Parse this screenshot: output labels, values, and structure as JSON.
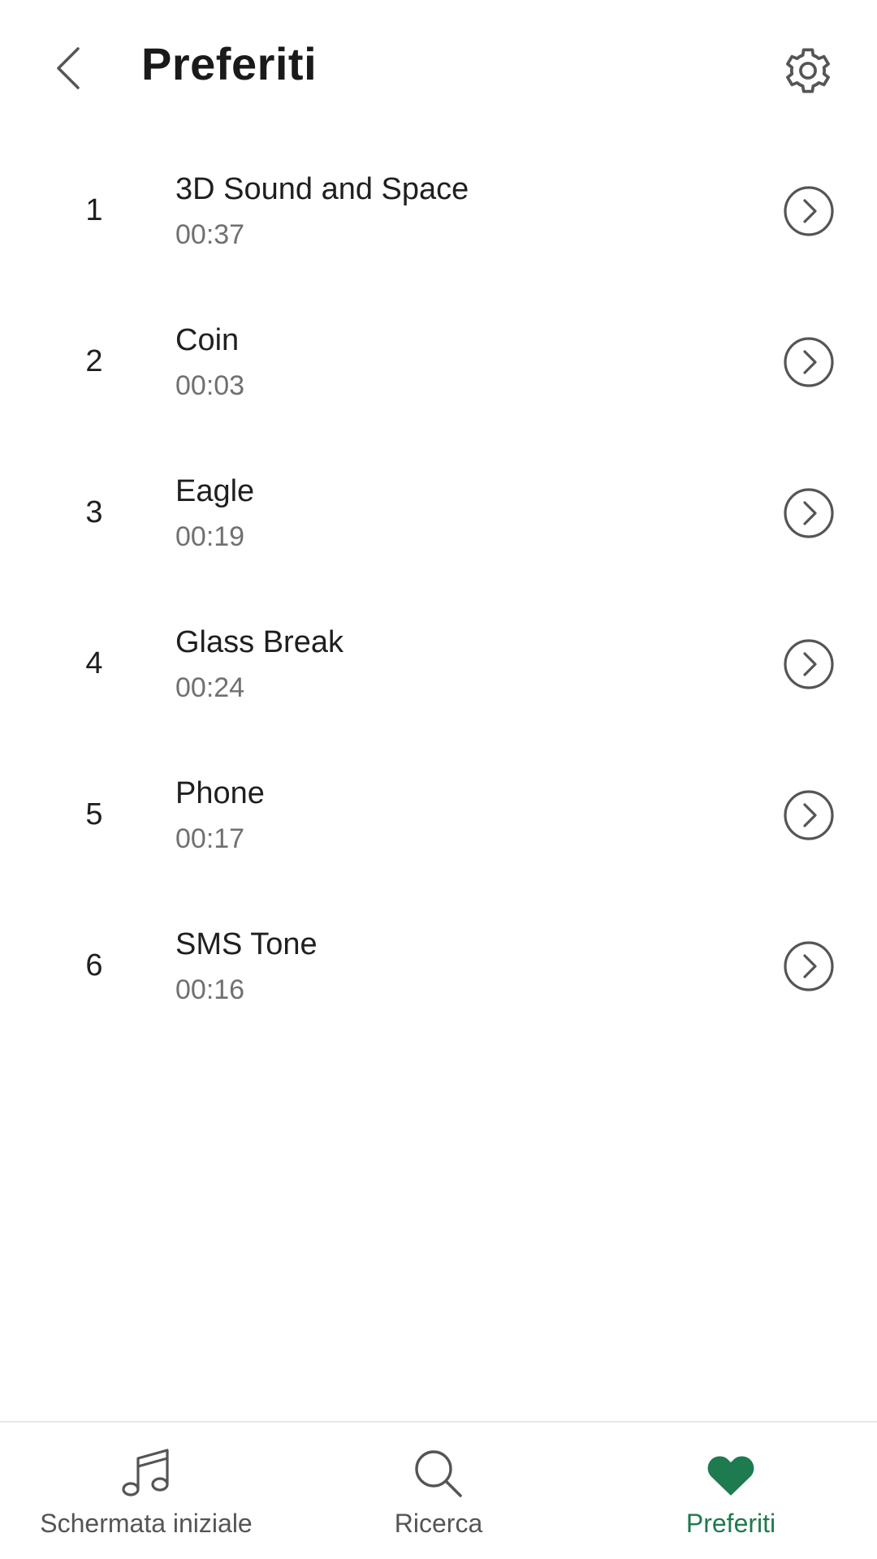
{
  "header": {
    "title": "Preferiti",
    "back_icon": "chevron-left-icon",
    "settings_icon": "gear-icon"
  },
  "items": [
    {
      "index": "1",
      "title": "3D Sound and Space",
      "duration": "00:37"
    },
    {
      "index": "2",
      "title": "Coin",
      "duration": "00:03"
    },
    {
      "index": "3",
      "title": "Eagle",
      "duration": "00:19"
    },
    {
      "index": "4",
      "title": "Glass Break",
      "duration": "00:24"
    },
    {
      "index": "5",
      "title": "Phone",
      "duration": "00:17"
    },
    {
      "index": "6",
      "title": "SMS Tone",
      "duration": "00:16"
    }
  ],
  "bottom_nav": {
    "home": {
      "label": "Schermata iniziale",
      "icon": "music-note-icon"
    },
    "search": {
      "label": "Ricerca",
      "icon": "search-icon"
    },
    "favorites": {
      "label": "Preferiti",
      "icon": "heart-icon",
      "active": true
    }
  },
  "colors": {
    "accent": "#1e7a4f",
    "text_primary": "#1f1f1f",
    "text_secondary": "#707070",
    "icon": "#555555"
  }
}
